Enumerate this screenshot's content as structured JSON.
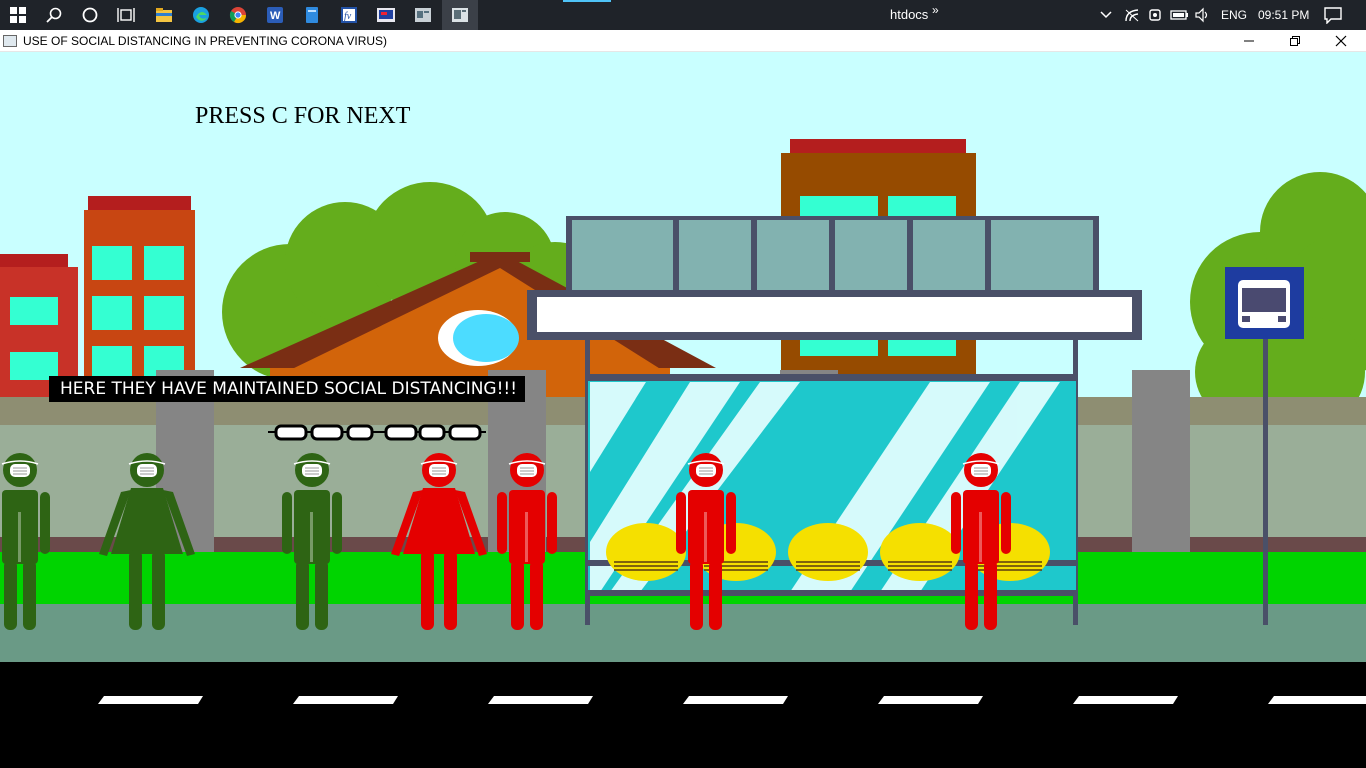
{
  "taskbar": {
    "folder_label": "htdocs",
    "overflow_label": "»",
    "language": "ENG",
    "time": "09:51 PM",
    "items": [
      "start-icon",
      "search-icon",
      "cortana-icon",
      "task-view-icon",
      "file-explorer-icon",
      "edge-icon",
      "chrome-icon",
      "word-icon",
      "notes-icon",
      "app-icon",
      "app-icon",
      "app-icon",
      "app-icon"
    ]
  },
  "window": {
    "title": "USE OF SOCIAL DISTANCING IN PREVENTING CORONA VIRUS)",
    "minimize_icon": "minimize-icon",
    "restore_icon": "restore-icon",
    "close_icon": "close-icon"
  },
  "scene": {
    "instruction": "PRESS C FOR NEXT",
    "caption": "HERE THEY HAVE MAINTAINED SOCIAL DISTANCING!!!",
    "colors": {
      "sky": "#c9ffff",
      "tree": "#64ad1c",
      "roof_red": "#b41e1e",
      "building_brown": "#964b00",
      "window_teal": "#34ffd2",
      "shelter_frame": "#4a5068",
      "shelter_glass": "#1ec8cc",
      "bench_yellow": "#f5e000",
      "wall_grey": "#9aae98",
      "grass": "#00d400",
      "pavement": "#6a9a86",
      "road": "#000000",
      "person_green": "#2e6414",
      "person_red": "#e40000",
      "bus_sign": "#1e3ca0"
    },
    "people": [
      {
        "group": "distanced",
        "color": "green",
        "type": "man"
      },
      {
        "group": "distanced",
        "color": "green",
        "type": "woman"
      },
      {
        "group": "distanced",
        "color": "green",
        "type": "man"
      },
      {
        "group": "crowded",
        "color": "red",
        "type": "woman"
      },
      {
        "group": "crowded",
        "color": "red",
        "type": "man"
      },
      {
        "group": "crowded",
        "color": "red",
        "type": "man"
      },
      {
        "group": "crowded",
        "color": "red",
        "type": "man"
      }
    ]
  }
}
